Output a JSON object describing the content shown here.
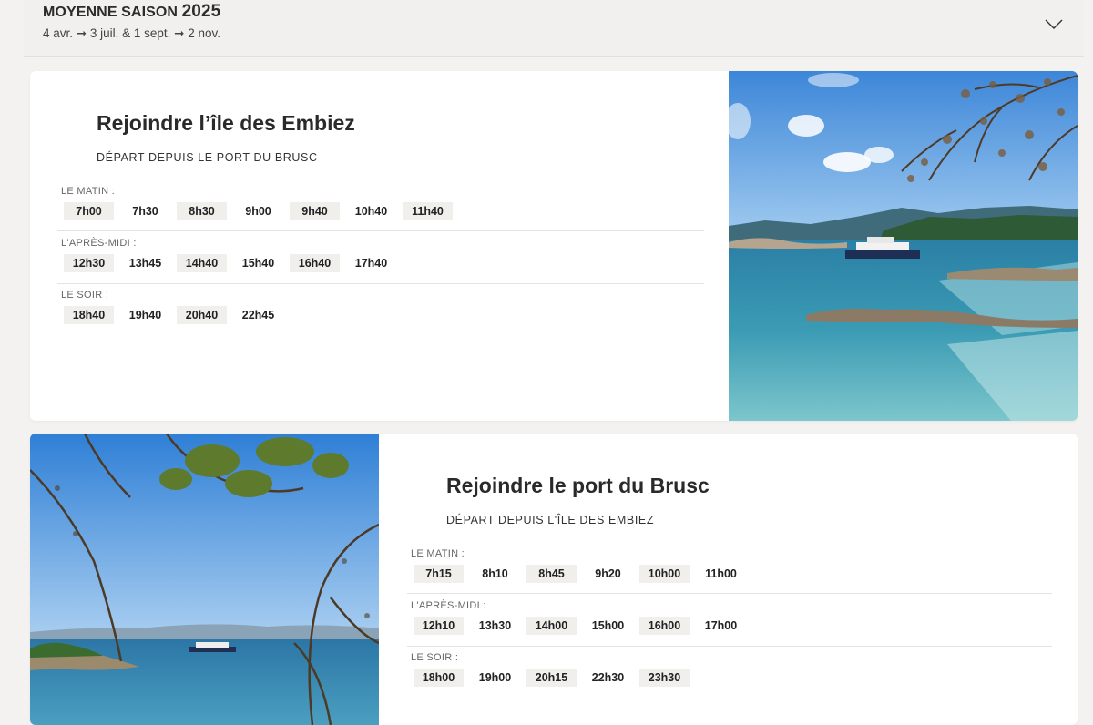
{
  "season": {
    "title": "MOYENNE SAISON",
    "year": "2025",
    "dates": "4 avr. ➞ 3 juil. & 1 sept. ➞ 2 nov.",
    "toggle_icon": "chevron-down-icon"
  },
  "routes": [
    {
      "title": "Rejoindre l’île des Embiez",
      "subtitle": "DÉPART DEPUIS LE PORT DU BRUSC",
      "periods": [
        {
          "label": "LE MATIN :",
          "times": [
            "7h00",
            "7h30",
            "8h30",
            "9h00",
            "9h40",
            "10h40",
            "11h40"
          ]
        },
        {
          "label": "L'APRÈS-MIDI :",
          "times": [
            "12h30",
            "13h45",
            "14h40",
            "15h40",
            "16h40",
            "17h40"
          ]
        },
        {
          "label": "LE SOIR :",
          "times": [
            "18h40",
            "19h40",
            "20h40",
            "22h45"
          ]
        }
      ]
    },
    {
      "title": "Rejoindre le port du Brusc",
      "subtitle": "DÉPART DEPUIS L'ÎLE DES EMBIEZ",
      "periods": [
        {
          "label": "LE MATIN :",
          "times": [
            "7h15",
            "8h10",
            "8h45",
            "9h20",
            "10h00",
            "11h00"
          ]
        },
        {
          "label": "L'APRÈS-MIDI :",
          "times": [
            "12h10",
            "13h30",
            "14h00",
            "15h00",
            "16h00",
            "17h00"
          ]
        },
        {
          "label": "LE SOIR :",
          "times": [
            "18h00",
            "19h00",
            "20h15",
            "22h30",
            "23h30"
          ]
        }
      ]
    }
  ]
}
